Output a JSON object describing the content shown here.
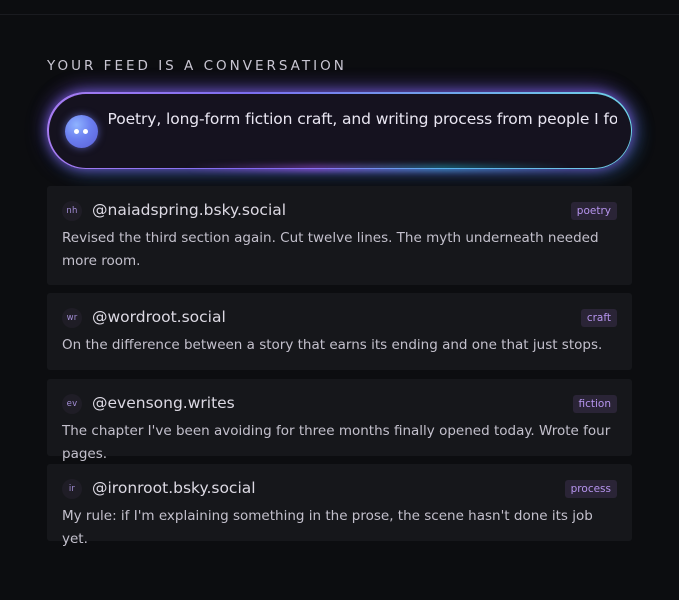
{
  "feed": {
    "heading": "YOUR FEED IS A CONVERSATION",
    "prompt": {
      "avatar_icon": "bot-face-icon",
      "text": "Poetry, long-form fiction craft, and writing process from people I follow",
      "gradient_colors": [
        "#a77cf3",
        "#7b6ef0",
        "#6fa6ea",
        "#6fd3e8"
      ]
    },
    "posts": [
      {
        "initials": "nh",
        "handle": "@naiadspring.bsky.social",
        "tag": "poetry",
        "text": "Revised the third section again. Cut twelve lines. The myth underneath needed more room."
      },
      {
        "initials": "wr",
        "handle": "@wordroot.social",
        "tag": "craft",
        "text": "On the difference between a story that earns its ending and one that just stops."
      },
      {
        "initials": "ev",
        "handle": "@evensong.writes",
        "tag": "fiction",
        "text": "The chapter I've been avoiding for three months finally opened today. Wrote four pages."
      },
      {
        "initials": "ir",
        "handle": "@ironroot.bsky.social",
        "tag": "process",
        "text": "My rule: if I'm explaining something in the prose, the scene hasn't done its job yet."
      }
    ]
  },
  "colors": {
    "background": "#0c0d10",
    "card": "#16171b",
    "tag_bg": "#2a2436",
    "tag_text": "#b694ee",
    "accent": "#7b6ef0"
  }
}
